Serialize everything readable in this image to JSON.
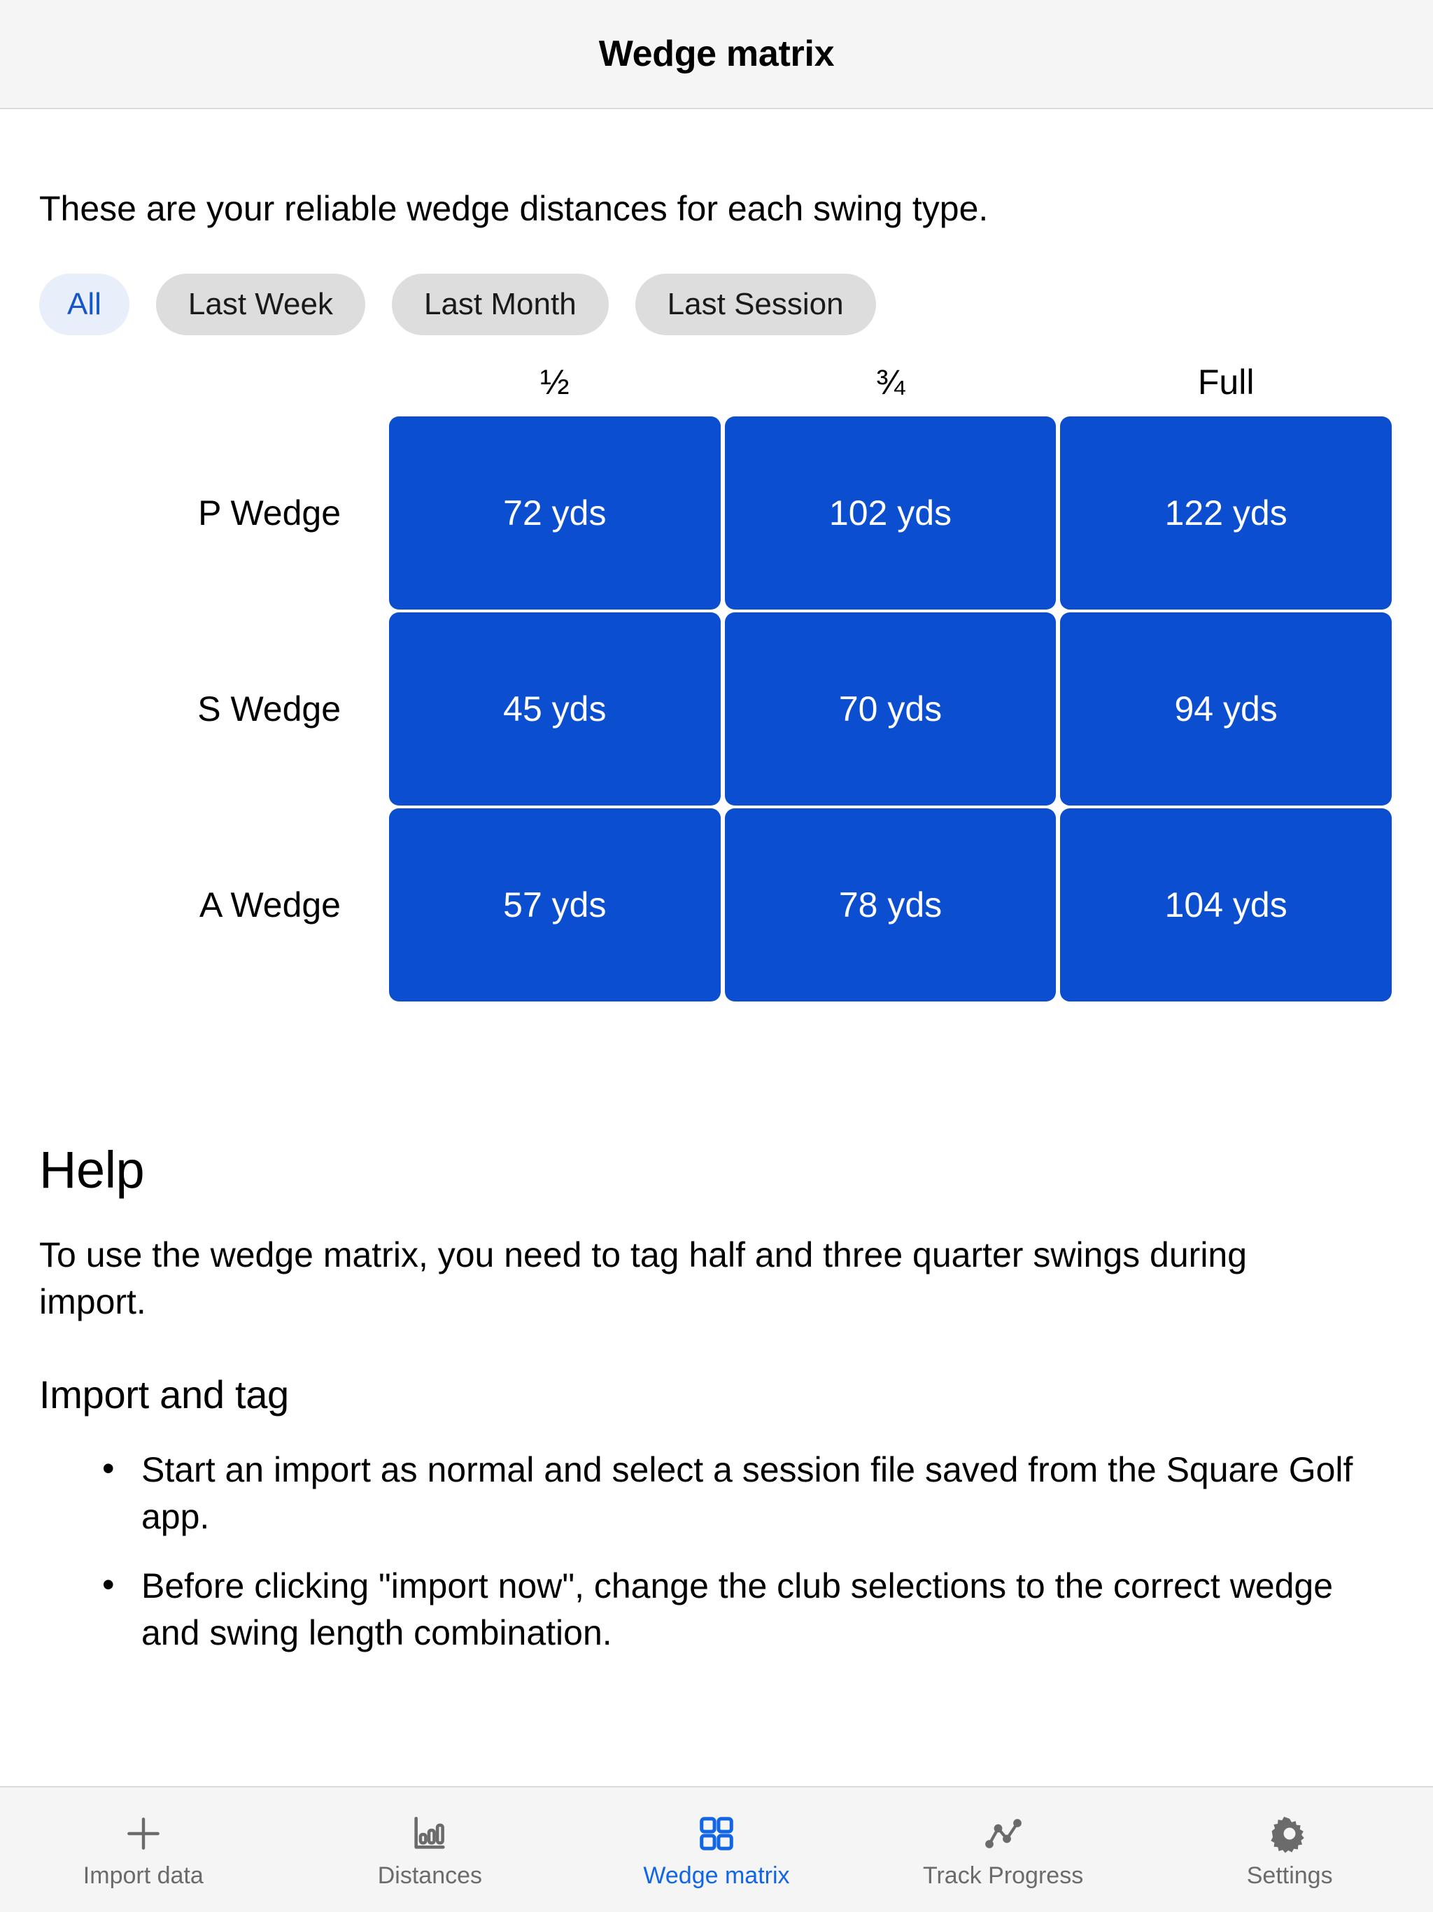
{
  "header": {
    "title": "Wedge matrix"
  },
  "main": {
    "intro": "These are your reliable wedge distances for each swing type.",
    "filters": [
      {
        "label": "All",
        "selected": true
      },
      {
        "label": "Last Week",
        "selected": false
      },
      {
        "label": "Last Month",
        "selected": false
      },
      {
        "label": "Last Session",
        "selected": false
      }
    ],
    "matrix": {
      "columns": [
        "½",
        "¾",
        "Full"
      ],
      "rows": [
        {
          "label": "P Wedge",
          "cells": [
            "72 yds",
            "102 yds",
            "122 yds"
          ]
        },
        {
          "label": "S Wedge",
          "cells": [
            "45 yds",
            "70 yds",
            "94 yds"
          ]
        },
        {
          "label": "A Wedge",
          "cells": [
            "57 yds",
            "78 yds",
            "104 yds"
          ]
        }
      ],
      "cell_color": "#0b4fd0",
      "cell_text_color": "#ffffff"
    }
  },
  "help": {
    "title": "Help",
    "body": "To use the wedge matrix, you need to tag half and three quarter swings during import.",
    "subtitle": "Import and tag",
    "bullets": [
      "Start an import as normal and select a session file saved from the Square Golf app.",
      "Before clicking \"import now\", change the club selections to the correct wedge and swing length combination."
    ]
  },
  "tabbar": {
    "active_color": "#1166e8",
    "inactive_color": "#6b6b6b",
    "items": [
      {
        "label": "Import data",
        "icon": "plus-icon",
        "active": false
      },
      {
        "label": "Distances",
        "icon": "bar-chart-icon",
        "active": false
      },
      {
        "label": "Wedge matrix",
        "icon": "grid-icon",
        "active": true
      },
      {
        "label": "Track Progress",
        "icon": "line-chart-icon",
        "active": false
      },
      {
        "label": "Settings",
        "icon": "gear-icon",
        "active": false
      }
    ]
  }
}
